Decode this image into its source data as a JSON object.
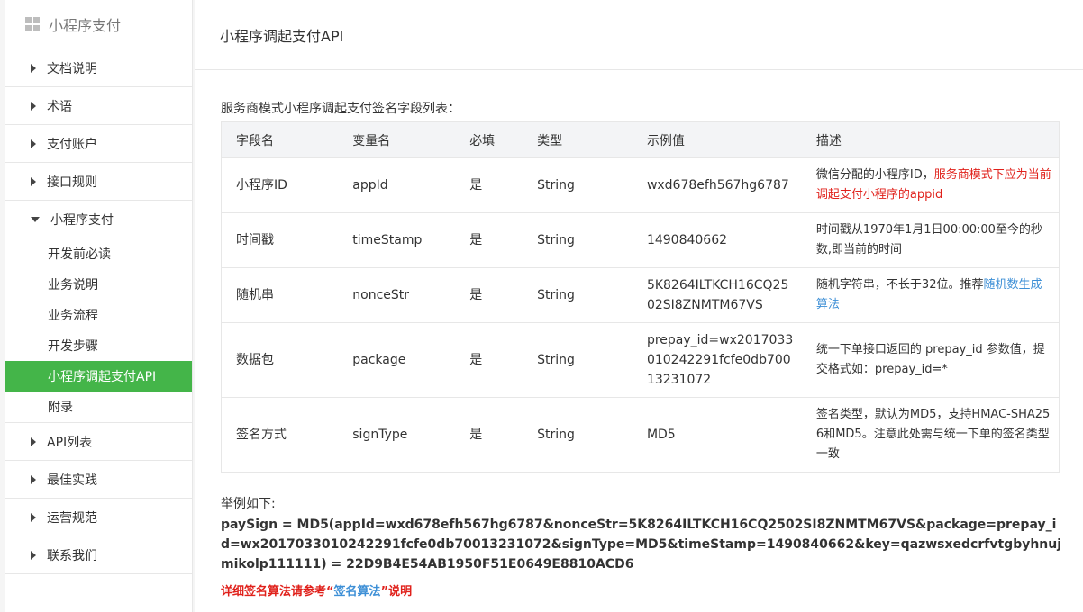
{
  "sidebar": {
    "title": "小程序支付",
    "items": [
      {
        "label": "文档说明"
      },
      {
        "label": "术语"
      },
      {
        "label": "支付账户"
      },
      {
        "label": "接口规则"
      }
    ],
    "open_group": {
      "label": "小程序支付",
      "subitems": [
        {
          "label": "开发前必读"
        },
        {
          "label": "业务说明"
        },
        {
          "label": "业务流程"
        },
        {
          "label": "开发步骤"
        },
        {
          "label": "小程序调起支付API"
        },
        {
          "label": "附录"
        }
      ]
    },
    "items_after": [
      {
        "label": "API列表"
      },
      {
        "label": "最佳实践"
      },
      {
        "label": "运营规范"
      },
      {
        "label": "联系我们"
      }
    ]
  },
  "main": {
    "title": "小程序调起支付API",
    "intro": "服务商模式小程序调起支付签名字段列表：",
    "table": {
      "headers": [
        "字段名",
        "变量名",
        "必填",
        "类型",
        "示例值",
        "描述"
      ],
      "rows": [
        {
          "name": "小程序ID",
          "var": "appId",
          "required": "是",
          "type": "String",
          "example": "wxd678efh567hg6787",
          "desc_plain": "微信分配的小程序ID，",
          "desc_red": "服务商模式下应为当前调起支付小程序的appid",
          "desc_link": "",
          "desc_tail": ""
        },
        {
          "name": "时间戳",
          "var": "timeStamp",
          "required": "是",
          "type": "String",
          "example": "1490840662",
          "desc_plain": "时间戳从1970年1月1日00:00:00至今的秒数,即当前的时间",
          "desc_red": "",
          "desc_link": "",
          "desc_tail": ""
        },
        {
          "name": "随机串",
          "var": "nonceStr",
          "required": "是",
          "type": "String",
          "example": "5K8264ILTKCH16CQ2502SI8ZNMTM67VS",
          "desc_plain": "随机字符串，不长于32位。推荐",
          "desc_red": "",
          "desc_link": "随机数生成算法",
          "desc_tail": ""
        },
        {
          "name": "数据包",
          "var": "package",
          "required": "是",
          "type": "String",
          "example": "prepay_id=wx2017033010242291fcfe0db70013231072",
          "desc_plain": "统一下单接口返回的 prepay_id 参数值，提交格式如：prepay_id=*",
          "desc_red": "",
          "desc_link": "",
          "desc_tail": ""
        },
        {
          "name": "签名方式",
          "var": "signType",
          "required": "是",
          "type": "String",
          "example": "MD5",
          "desc_plain": "签名类型，默认为MD5，支持HMAC-SHA256和MD5。注意此处需与统一下单的签名类型一致",
          "desc_red": "",
          "desc_link": "",
          "desc_tail": ""
        }
      ]
    },
    "example_label": "举例如下:",
    "paysign": "paySign = MD5(appId=wxd678efh567hg6787&nonceStr=5K8264ILTKCH16CQ2502SI8ZNMTM67VS&package=prepay_id=wx2017033010242291fcfe0db70013231072&signType=MD5&timeStamp=1490840662&key=qazwsxedcrfvtgbyhnujmikolp111111) = 22D9B4E54AB1950F51E0649E8810ACD6",
    "note": {
      "before": "详细签名算法请参考“",
      "link": "签名算法",
      "after": "”说明"
    }
  },
  "colors": {
    "accent": "#44b549",
    "red": "#e0211b",
    "link": "#3d8fd6"
  }
}
